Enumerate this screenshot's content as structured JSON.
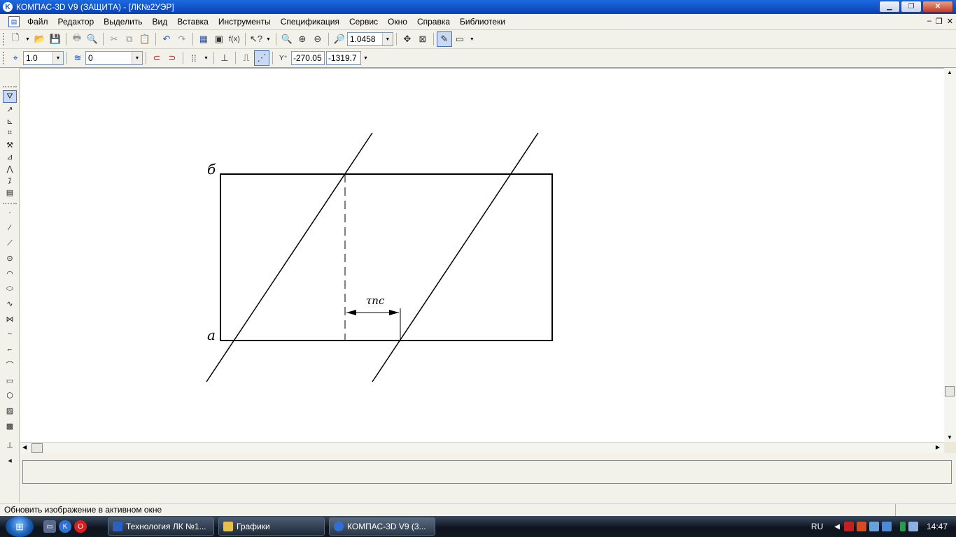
{
  "window": {
    "title": "КОМПАС-3D V9 (ЗАЩИТА) - [ЛК№2УЭР]"
  },
  "menu": [
    "Файл",
    "Редактор",
    "Выделить",
    "Вид",
    "Вставка",
    "Инструменты",
    "Спецификация",
    "Сервис",
    "Окно",
    "Справка",
    "Библиотеки"
  ],
  "toolbar1": {
    "zoom_value": "1.0458"
  },
  "toolbar2": {
    "step_value": "1.0",
    "layer_value": "0",
    "coord_x": "-270.05",
    "coord_y": "-1319.7"
  },
  "drawing": {
    "label_top": "б",
    "label_bottom": "а",
    "dimension_label": "τпс"
  },
  "status": {
    "message": "Обновить изображение в активном окне"
  },
  "taskbar": {
    "tasks": [
      "Технология ЛК №1...",
      "Графики",
      "КОМПАС-3D V9 (3..."
    ],
    "lang": "RU",
    "clock": "14:47"
  }
}
